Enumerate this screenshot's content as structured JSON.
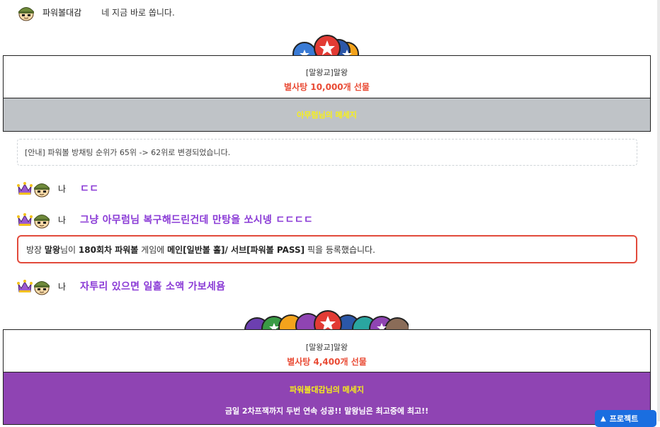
{
  "messages": [
    {
      "nick": "파워볼대감",
      "text": "네 지금 바로 쏩니다.",
      "icon": "soldier-avatar-icon"
    },
    {
      "nick": "나",
      "text": "ㄷㄷ",
      "icon": "crown-soldier-avatar-icon"
    },
    {
      "nick": "나",
      "text": "그냥 아무럼님 복구해드린건데 만탕을 쏘시넹 ㄷㄷㄷㄷ",
      "icon": "crown-soldier-avatar-icon"
    },
    {
      "nick": "나",
      "text": "자투리 있으면 일홀 소액 가보세욤",
      "icon": "crown-soldier-avatar-icon"
    }
  ],
  "gift1": {
    "sender": "[말왕교]말왕",
    "amount": "별사탕 10,000개 선물"
  },
  "message_header1": {
    "title": "아무럼님의 메세지",
    "bg_color": "#bfc3c7"
  },
  "notice": "[안내] 파워볼 방채팅 순위가 65위 -> 62위로 변경되었습니다.",
  "pick_notice": {
    "p1": "방장 ",
    "b1": "말왕",
    "p2": "님이 ",
    "b2": "180회차 파워볼",
    "p3": " 게임에 ",
    "b3": "메인[일반볼 홀]/ 서브[파워볼 PASS]",
    "p4": " 픽을 등록했습니다."
  },
  "gift2": {
    "sender": "[말왕교]말왕",
    "amount": "별사탕 4,400개 선물"
  },
  "message_header2": {
    "title": "파워볼대감님의 메세지",
    "body": "금일 2차프잭까지 두번 연속 성공!! 말왕님은 최고중에 최고!!",
    "bg_color": "#8f44b3"
  },
  "floating_button": {
    "label": "프로젝트",
    "icon": "chevron-up-icon"
  },
  "colors": {
    "accent_red": "#e94b35",
    "accent_purple": "#8a3ad6",
    "title_yellow": "#f7ef1a",
    "button_blue": "#1a6ee0"
  }
}
